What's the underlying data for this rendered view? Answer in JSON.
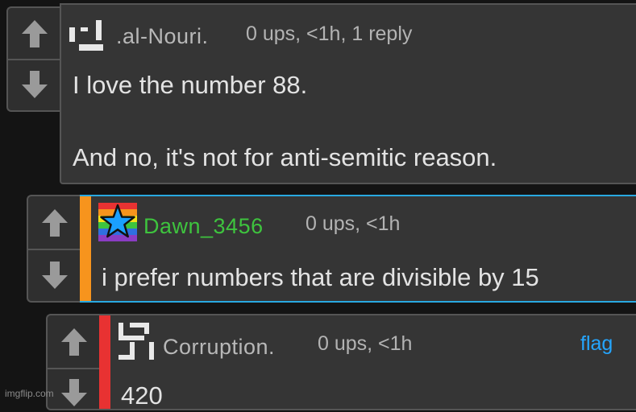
{
  "comments": [
    {
      "username": ".al-Nouri.",
      "meta": "0 ups, <1h, 1 reply",
      "body_line1": "I love the number 88.",
      "body_line2": "And no, it's not for anti-semitic reason.",
      "username_color": "#b8b8b8"
    },
    {
      "username": "Dawn_3456",
      "meta": "0 ups, <1h",
      "body_line1": "i prefer numbers that are divisible by 15",
      "username_color": "#3ec43e",
      "stripe_color": "#f7941d",
      "border_color": "#29a9e1"
    },
    {
      "username": "Corruption.",
      "meta": "0 ups, <1h",
      "body_line1": "420",
      "flag_label": "flag",
      "username_color": "#b8b8b8",
      "stripe_color": "#e83232"
    }
  ],
  "watermark": "imgflip.com",
  "icons": {
    "upvote": "up-arrow-icon",
    "downvote": "down-arrow-icon"
  }
}
